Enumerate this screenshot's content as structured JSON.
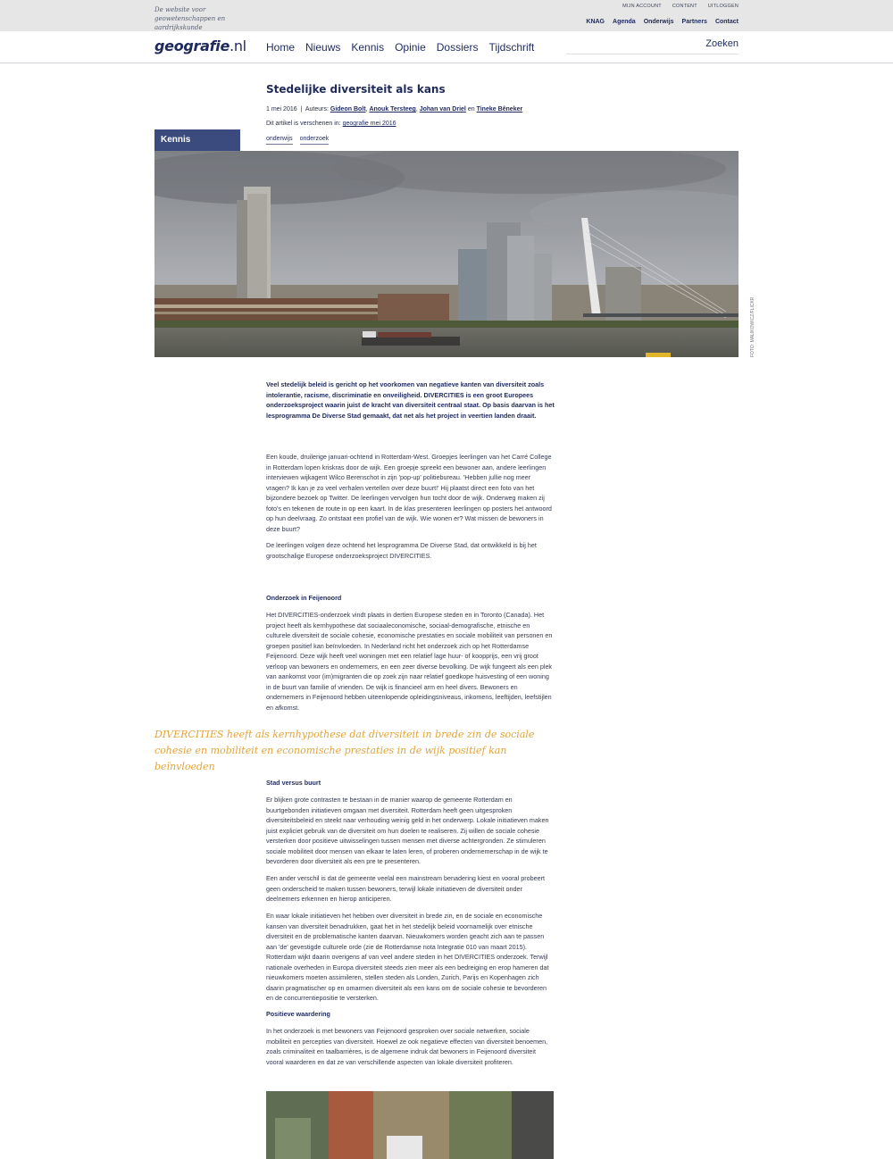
{
  "top": {
    "tagline": "De website voor geowetenschappen en aardrijkskunde",
    "utility": [
      "MIJN ACCOUNT",
      "CONTENT",
      "UITLOGGEN"
    ],
    "secondary_nav": [
      "KNAG",
      "Agenda",
      "Onderwijs",
      "Partners",
      "Contact"
    ]
  },
  "header": {
    "logo_bold": "geografie",
    "logo_rest": ".nl",
    "nav": [
      "Home",
      "Nieuws",
      "Kennis",
      "Opinie",
      "Dossiers",
      "Tijdschrift"
    ],
    "search_label": "Zoeken"
  },
  "article": {
    "section": "Kennis",
    "title": "Stedelijke diversiteit als kans",
    "date": "1 mei 2016",
    "authors_prefix": "Auteurs:",
    "authors": [
      "Gideon Bolt",
      "Anouk Tersteeg",
      "Johan van Driel",
      "Tineke Bêneker"
    ],
    "and_word": "en",
    "published_prefix": "Dit artikel is verschenen in:",
    "published_link": "geografie mei 2016",
    "tags": [
      "onderwijs",
      "onderzoek"
    ],
    "photo_credit": "FOTO: MALIKOWICZ/FLICKR",
    "lead": "Veel stedelijk beleid is gericht op het voorkomen van negatieve kanten van diversiteit zoals intolerantie, racisme, discriminatie en onveiligheid. DIVERCITIES is een groot Europees onderzoeksproject waarin juist de kracht van diversiteit centraal staat. Op basis daarvan is het lesprogramma De Diverse Stad gemaakt, dat net als het project in veertien landen draait.",
    "p1": "Een koude, druilerige januari-ochtend in Rotterdam-West. Groepjes leerlingen van het Carré College in Rotterdam lopen kriskras door de wijk. Een groepje spreekt een bewoner aan, andere leerlingen interviewen wijkagent Wilco Berenschot in zijn 'pop-up' politiebureau. 'Hebben jullie nog meer vragen? Ik kan je zo veel verhalen vertellen over deze buurt!' Hij plaatst direct een foto van het bijzondere bezoek op Twitter. De leerlingen vervolgen hun tocht door de wijk. Onderweg maken zij foto's en tekenen de route in op een kaart. In de klas presenteren leerlingen op posters het antwoord op hun deelvraag. Zo ontstaat een profiel van de wijk. Wie wonen er? Wat missen de bewoners in deze buurt?",
    "p2": "De leerlingen volgen deze ochtend het lesprogramma De Diverse Stad, dat ontwikkeld is bij het grootschalige Europese onderzoeksproject DIVERCITIES.",
    "h1": "Onderzoek in Feijenoord",
    "p3": "Het DIVERCITIES-onderzoek vindt plaats in dertien Europese steden en in Toronto (Canada). Het project heeft als kernhypothese dat sociaaleconomische, sociaal-demografische, etnische en culturele diversiteit de sociale cohesie, economische prestaties en sociale mobiliteit van personen en groepen positief kan beïnvloeden. In Nederland richt het onderzoek zich op het Rotterdamse Feijenoord. Deze wijk heeft veel woningen met een relatief lage huur- of koopprijs, een vrij groot verloop van bewoners en ondernemers, en een zeer diverse bevolking. De wijk fungeert als een plek van aankomst voor (im)migranten die op zoek zijn naar relatief goedkope huisvesting of een woning in de buurt van familie of vrienden. De wijk is financieel arm en heel divers. Bewoners en ondernemers in Feijenoord hebben uiteenlopende opleidingsniveaus, inkomens, leeftijden, leefstijlen en afkomst.",
    "quote": "DIVERCITIES heeft als kernhypothese dat diversiteit in brede zin de sociale cohesie en mobiliteit en economische prestaties in de wijk positief kan beïnvloeden",
    "h2": "Stad versus buurt",
    "p4": "Er blijken grote contrasten te bestaan in de manier waarop de gemeente Rotterdam en buurtgebonden initiatieven omgaan met diversiteit. Rotterdam heeft geen uitgesproken diversiteitsbeleid en steekt naar verhouding weinig geld in het onderwerp. Lokale initiatieven maken juist expliciet gebruik van de diversiteit om hun doelen te realiseren. Zij willen de sociale cohesie versterken door positieve uitwisselingen tussen mensen met diverse achtergronden. Ze stimuleren sociale mobiliteit door mensen van elkaar te laten leren, of proberen ondernemerschap in de wijk te bevorderen door diversiteit als een pre te presenteren.",
    "p5": "Een ander verschil is dat de gemeente veelal een mainstream benadering kiest en vooral probeert geen onderscheid te maken tussen bewoners, terwijl lokale initiatieven de diversiteit onder deelnemers erkennen en hierop anticiperen.",
    "p6": "En waar lokale initiatieven het hebben over diversiteit in brede zin, en de sociale en economische kansen van diversiteit benadrukken, gaat het in het stedelijk beleid voornamelijk over etnische diversiteit en de problematische kanten daarvan. Nieuwkomers worden geacht zich aan te passen aan 'de' gevestigde culturele orde (zie de Rotterdamse nota Integratie 010 van maart 2015). Rotterdam wijkt daarin overigens af van veel andere steden in het DIVERCITIES onderzoek. Terwijl nationale overheden in Europa diversiteit steeds zien meer als een bedreiging en erop hameren dat nieuwkomers moeten assimileren, stellen steden als Londen, Zurich, Parijs en Kopenhagen zich daarin pragmatischer op en omarmen diversiteit als een kans om de sociale cohesie te bevorderen en de concurrentiepositie te versterken.",
    "h3": "Positieve waardering",
    "p7": "In het onderzoek is met bewoners van Feijenoord gesproken over sociale netwerken, sociale mobiliteit en percepties van diversiteit. Hoewel ze ook negatieve effecten van diversiteit benoemen, zoals criminaliteit en taalbarrières, is de algemene indruk dat bewoners in Feijenoord diversiteit vooral waarderen en dat ze van verschillende aspecten van lokale diversiteit profiteren."
  }
}
